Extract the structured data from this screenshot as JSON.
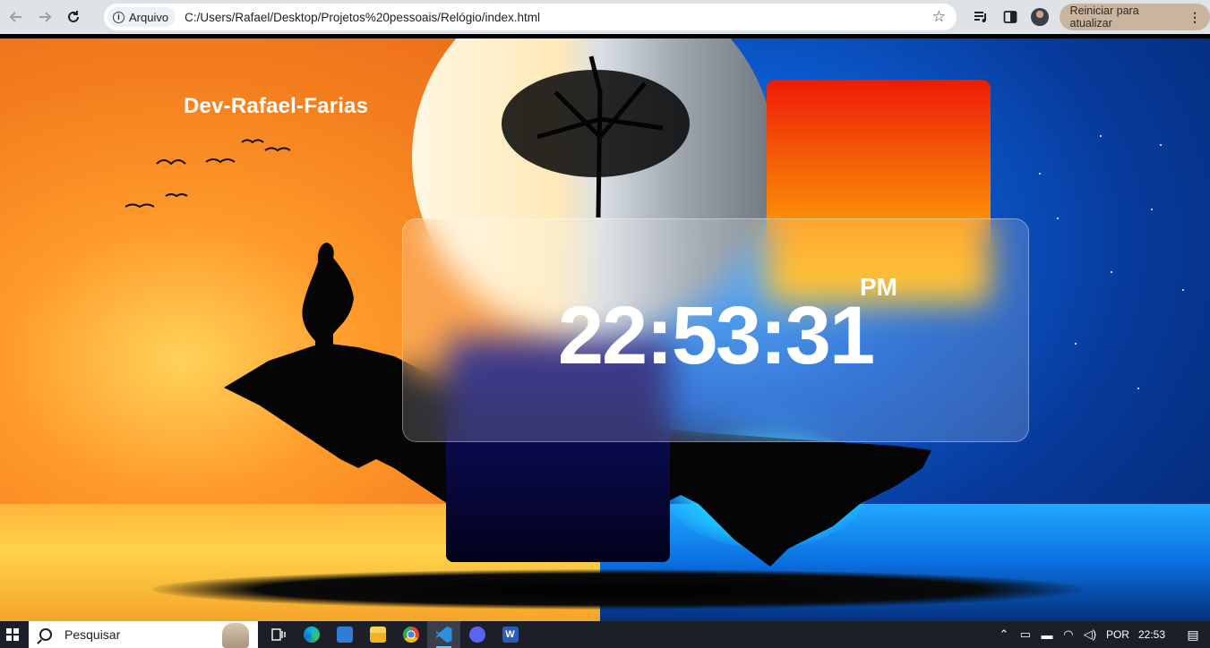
{
  "browser": {
    "security_chip": "Arquivo",
    "url": "C:/Users/Rafael/Desktop/Projetos%20pessoais/Relógio/index.html",
    "update_button": "Reiniciar para atualizar"
  },
  "page": {
    "brand": "Dev-Rafael-Farias",
    "clock": {
      "time": "22:53:31",
      "period": "PM"
    }
  },
  "taskbar": {
    "search_placeholder": "Pesquisar",
    "language": "POR",
    "time": "22:53",
    "apps": [
      "task-view",
      "edge",
      "news",
      "file-explorer",
      "chrome",
      "vscode",
      "discord",
      "word"
    ]
  },
  "colors": {
    "square_top": "#ee1a06",
    "square_bottom": "#15117e",
    "update_button_bg": "#c9b59d",
    "taskbar_bg": "#1d1f28"
  }
}
